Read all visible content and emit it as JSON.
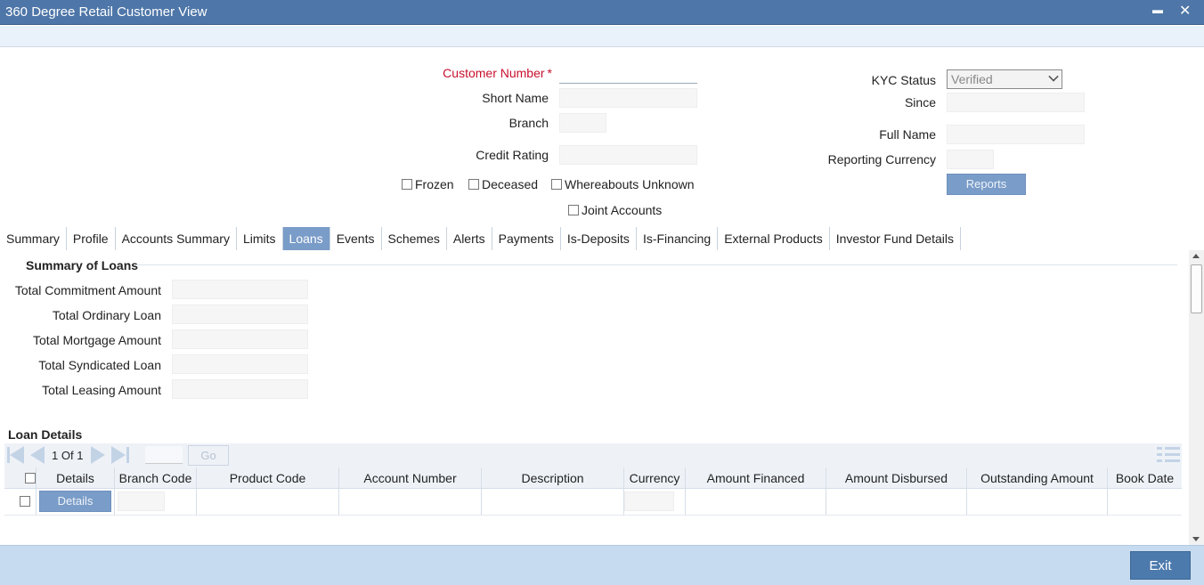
{
  "window": {
    "title": "360 Degree Retail Customer View",
    "minimize_glyph": "▬",
    "close_glyph": "✕"
  },
  "header": {
    "customer_number_label": "Customer Number",
    "required_mark": "*",
    "short_name_label": "Short Name",
    "branch_label": "Branch",
    "credit_rating_label": "Credit Rating",
    "kyc_status_label": "KYC Status",
    "kyc_status_value": "Verified",
    "since_label": "Since",
    "full_name_label": "Full Name",
    "reporting_currency_label": "Reporting Currency",
    "reports_button": "Reports",
    "frozen_label": "Frozen",
    "deceased_label": "Deceased",
    "whereabouts_label": "Whereabouts Unknown",
    "joint_accounts_label": "Joint Accounts"
  },
  "tabs": [
    {
      "label": "Summary"
    },
    {
      "label": "Profile"
    },
    {
      "label": "Accounts Summary"
    },
    {
      "label": "Limits"
    },
    {
      "label": "Loans"
    },
    {
      "label": "Events"
    },
    {
      "label": "Schemes"
    },
    {
      "label": "Alerts"
    },
    {
      "label": "Payments"
    },
    {
      "label": "Is-Deposits"
    },
    {
      "label": "Is-Financing"
    },
    {
      "label": "External Products"
    },
    {
      "label": "Investor Fund Details"
    }
  ],
  "active_tab": "Loans",
  "summary": {
    "title": "Summary of Loans",
    "total_commitment_label": "Total Commitment Amount",
    "total_ordinary_label": "Total Ordinary Loan",
    "total_mortgage_label": "Total Mortgage Amount",
    "total_syndicated_label": "Total Syndicated Loan",
    "total_leasing_label": "Total Leasing Amount"
  },
  "loan_details": {
    "title": "Loan Details",
    "pager": {
      "current": "1",
      "of_label": "Of",
      "total": "1",
      "go_label": "Go"
    },
    "columns": [
      "Details",
      "Branch Code",
      "Product Code",
      "Account Number",
      "Description",
      "Currency",
      "Amount Financed",
      "Amount Disbursed",
      "Outstanding Amount",
      "Book Date"
    ],
    "row_details_button": "Details"
  },
  "footer": {
    "exit_label": "Exit"
  }
}
